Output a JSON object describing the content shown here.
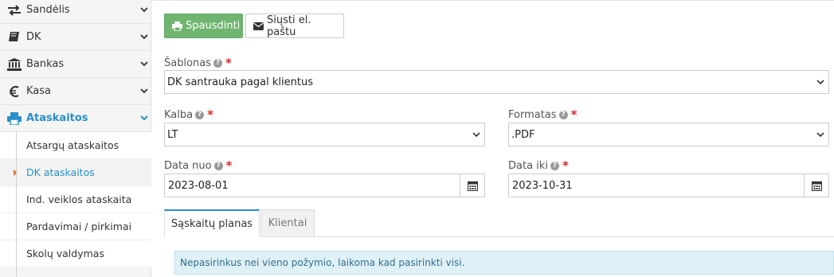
{
  "sidebar": {
    "items": [
      {
        "label": "Sandėlis",
        "icon": "arrows-exchange-icon"
      },
      {
        "label": "DK",
        "icon": "book-icon"
      },
      {
        "label": "Bankas",
        "icon": "bank-icon"
      },
      {
        "label": "Kasa",
        "icon": "euro-icon"
      },
      {
        "label": "Ataskaitos",
        "icon": "print-icon"
      }
    ],
    "subitems": [
      {
        "label": "Atsargų ataskaitos"
      },
      {
        "label": "DK ataskaitos"
      },
      {
        "label": "Ind. veiklos ataskaita"
      },
      {
        "label": "Pardavimai / pirkimai"
      },
      {
        "label": "Skolų valdymas"
      }
    ]
  },
  "toolbar": {
    "print_label": "Spausdinti",
    "email_label": "Siųsti el. paštu"
  },
  "form": {
    "template": {
      "label": "Šablonas",
      "value": "DK santrauka pagal klientus"
    },
    "language": {
      "label": "Kalba",
      "value": "LT"
    },
    "format": {
      "label": "Formatas",
      "value": ".PDF"
    },
    "date_from": {
      "label": "Data nuo",
      "value": "2023-08-01"
    },
    "date_to": {
      "label": "Data iki",
      "value": "2023-10-31"
    },
    "help_glyph": "?",
    "required_mark": "*"
  },
  "tabs": [
    {
      "label": "Sąskaitų planas",
      "active": true
    },
    {
      "label": "Klientai",
      "active": false
    }
  ],
  "info_text": "Nepasirinkus nei vieno požymio, laikoma kad pasirinkti visi.",
  "colors": {
    "accent": "#2a8fc9",
    "print_button": "#6fb56f",
    "required": "#d9292b",
    "info_bg": "#dff0f7"
  }
}
